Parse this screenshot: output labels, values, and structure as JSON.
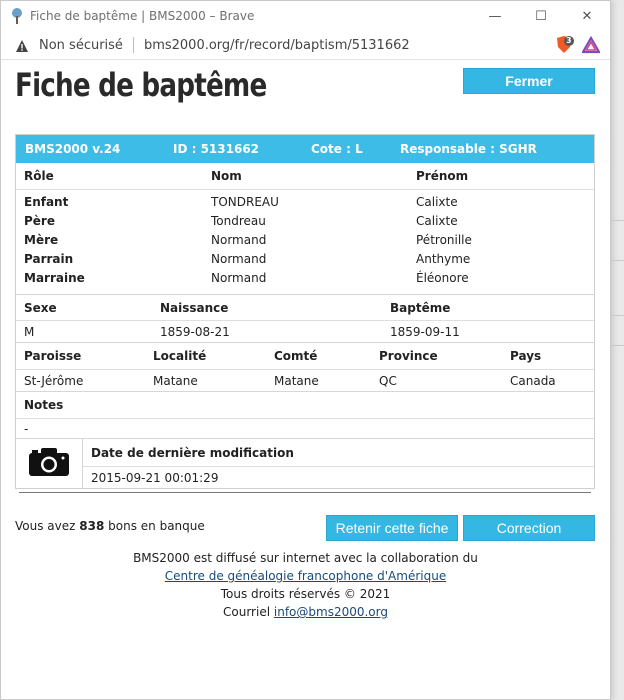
{
  "window": {
    "title": "Fiche de baptême | BMS2000 – Brave",
    "controls": {
      "minimize": "—",
      "maximize": "☐",
      "close": "✕"
    }
  },
  "address_bar": {
    "security_label": "Non sécurisé",
    "url": "bms2000.org/fr/record/baptism/5131662",
    "brave_count": "3"
  },
  "page": {
    "title": "Fiche de baptême",
    "close_button": "Fermer"
  },
  "record_header": {
    "version": "BMS2000 v.24",
    "id": "ID : 5131662",
    "cote": "Cote : L",
    "responsable": "Responsable : SGHR"
  },
  "people": {
    "headers": [
      "Rôle",
      "Nom",
      "Prénom"
    ],
    "rows": [
      {
        "role": "Enfant",
        "nom": "TONDREAU",
        "prenom": "Calixte"
      },
      {
        "role": "Père",
        "nom": "Tondreau",
        "prenom": "Calixte"
      },
      {
        "role": "Mère",
        "nom": "Normand",
        "prenom": "Pétronille"
      },
      {
        "role": "Parrain",
        "nom": "Normand",
        "prenom": "Anthyme"
      },
      {
        "role": "Marraine",
        "nom": "Normand",
        "prenom": "Éléonore"
      }
    ]
  },
  "event": {
    "headers": [
      "Sexe",
      "Naissance",
      "Baptême"
    ],
    "values": [
      "M",
      "1859-08-21",
      "1859-09-11"
    ]
  },
  "place": {
    "headers": [
      "Paroisse",
      "Localité",
      "Comté",
      "Province",
      "Pays"
    ],
    "values": [
      "St-Jérôme",
      "Matane",
      "Matane",
      "QC",
      "Canada"
    ]
  },
  "notes": {
    "header": "Notes",
    "value": "-"
  },
  "modification": {
    "header": "Date de dernière modification",
    "value": "2015-09-21 00:01:29"
  },
  "bank": {
    "prefix": "Vous avez",
    "count": "838",
    "suffix": "bons en banque"
  },
  "actions": {
    "keep": "Retenir cette fiche",
    "correction": "Correction"
  },
  "footer": {
    "line1": "BMS2000 est diffusé sur internet avec la collaboration du",
    "link": "Centre de généalogie francophone d'Amérique",
    "rights": "Tous droits réservés © 2021",
    "mail_label": "Courriel",
    "mail": "info@bms2000.org"
  },
  "colors": {
    "accent": "#3cbce7",
    "button": "#34b7e3"
  }
}
